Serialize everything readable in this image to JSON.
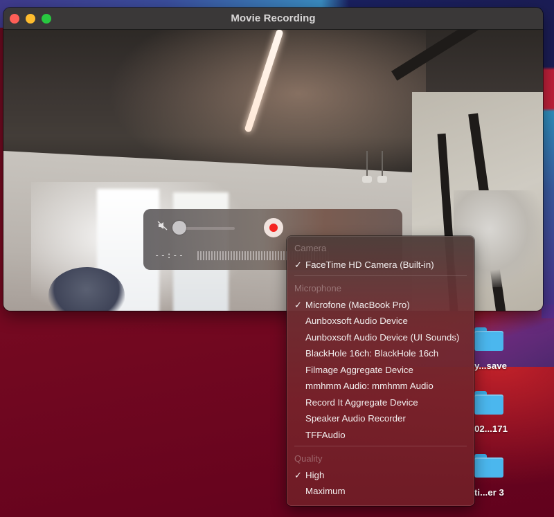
{
  "window": {
    "title": "Movie Recording",
    "traffic_lights": {
      "close": "close-button",
      "minimize": "minimize-button",
      "zoom": "zoom-button"
    }
  },
  "hud": {
    "mute_icon": "speaker-muted-icon",
    "volume_level": 0,
    "record_icon": "record-dot-icon",
    "timecode": "--:--",
    "audio_meter_peak_fraction": 0.85
  },
  "menu": {
    "sections": [
      {
        "header": "Camera",
        "items": [
          {
            "label": "FaceTime HD Camera (Built-in)",
            "checked": true
          }
        ]
      },
      {
        "header": "Microphone",
        "items": [
          {
            "label": "Microfone (MacBook Pro)",
            "checked": true
          },
          {
            "label": "Aunboxsoft Audio Device",
            "checked": false
          },
          {
            "label": "Aunboxsoft Audio Device (UI Sounds)",
            "checked": false
          },
          {
            "label": "BlackHole 16ch: BlackHole 16ch",
            "checked": false
          },
          {
            "label": "Filmage Aggregate Device",
            "checked": false
          },
          {
            "label": "mmhmm Audio: mmhmm Audio",
            "checked": false
          },
          {
            "label": "Record It Aggregate Device",
            "checked": false
          },
          {
            "label": "Speaker Audio Recorder",
            "checked": false
          },
          {
            "label": "TFFAudio",
            "checked": false
          }
        ]
      },
      {
        "header": "Quality",
        "items": [
          {
            "label": "High",
            "checked": true
          },
          {
            "label": "Maximum",
            "checked": false
          }
        ]
      }
    ],
    "check_glyph": "✓"
  },
  "desktop": {
    "folders": [
      {
        "label": "y...save",
        "icon": "folder-icon"
      },
      {
        "label": "02...171",
        "icon": "folder-icon"
      },
      {
        "label": "ti...er 3",
        "icon": "folder-icon"
      }
    ]
  },
  "colors": {
    "record_red": "#f4231f",
    "close": "#fe5f57",
    "minimize": "#febc2e",
    "zoom": "#28c840",
    "folder_blue": "#4bb7ee"
  }
}
